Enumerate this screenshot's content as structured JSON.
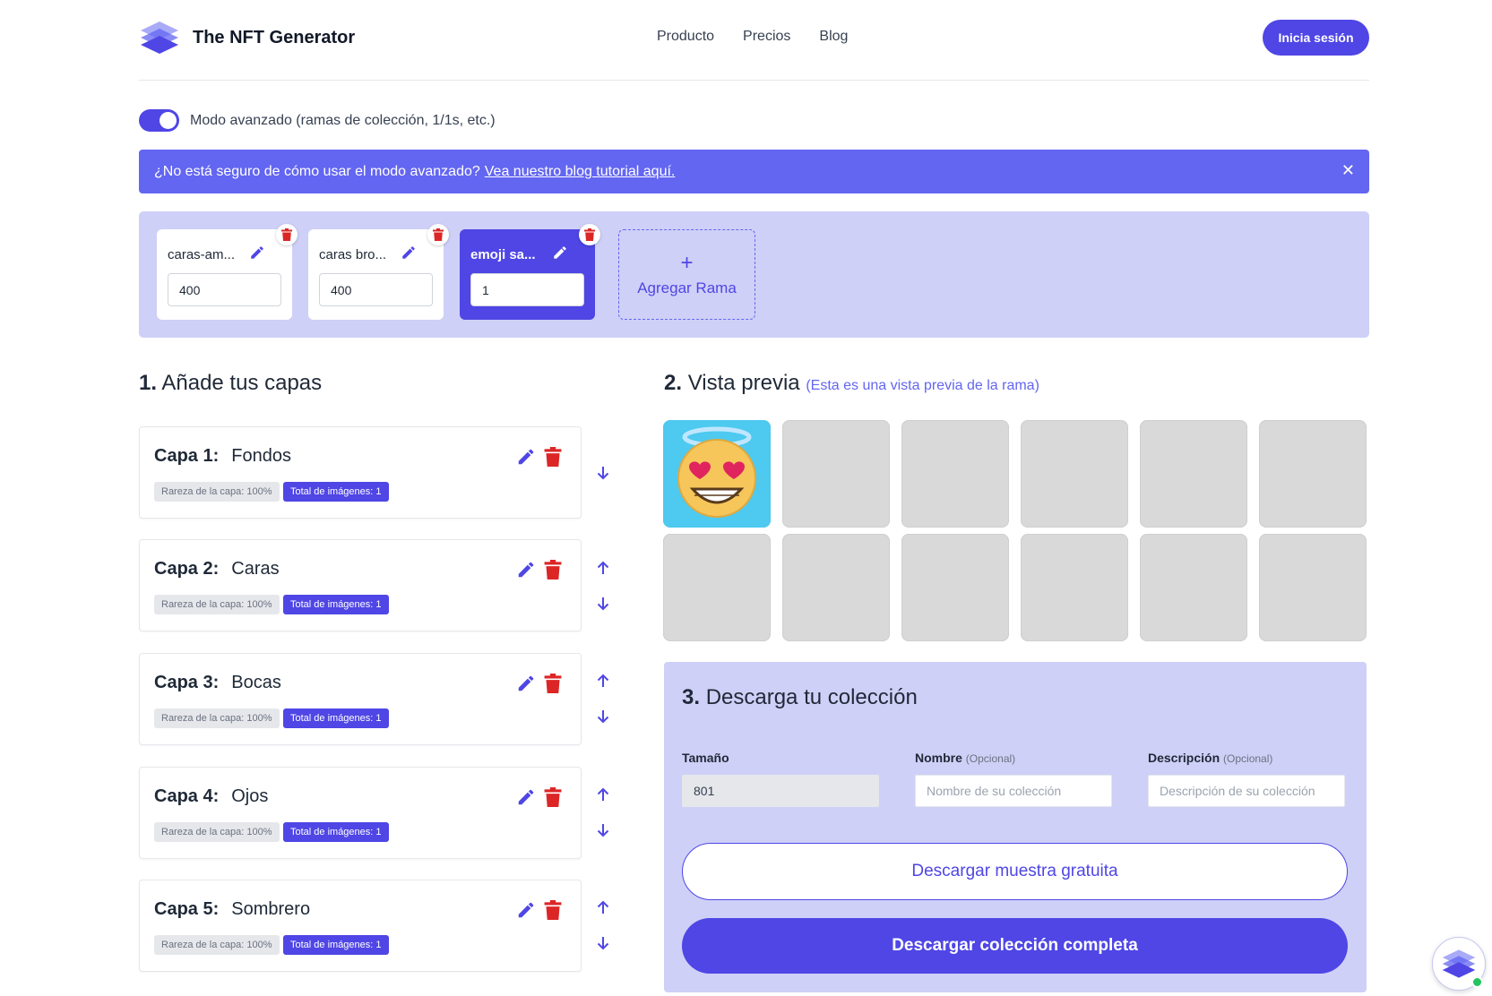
{
  "header": {
    "brand": "The NFT Generator",
    "nav": [
      "Producto",
      "Precios",
      "Blog"
    ],
    "login_label": "Inicia sesión"
  },
  "advanced": {
    "enabled": true,
    "label": "Modo avanzado (ramas de colección, 1/1s, etc.)"
  },
  "banner": {
    "text": "¿No está seguro de cómo usar el modo avanzado?",
    "link": "Vea nuestro blog tutorial aquí.",
    "close": "✕"
  },
  "branches": [
    {
      "name": "caras-am...",
      "value": "400",
      "active": false
    },
    {
      "name": "caras bro...",
      "value": "400",
      "active": false
    },
    {
      "name": "emoji sa...",
      "value": "1",
      "active": true
    }
  ],
  "add_branch": {
    "plus": "+",
    "label": "Agregar Rama"
  },
  "section1": {
    "num": "1.",
    "title": "Añade tus capas"
  },
  "layers": [
    {
      "label": "Capa 1:",
      "name": "Fondos",
      "rarity": "Rareza de la capa: 100%",
      "total": "Total de imágenes: 1"
    },
    {
      "label": "Capa 2:",
      "name": "Caras",
      "rarity": "Rareza de la capa: 100%",
      "total": "Total de imágenes: 1"
    },
    {
      "label": "Capa 3:",
      "name": "Bocas",
      "rarity": "Rareza de la capa: 100%",
      "total": "Total de imágenes: 1"
    },
    {
      "label": "Capa 4:",
      "name": "Ojos",
      "rarity": "Rareza de la capa: 100%",
      "total": "Total de imágenes: 1"
    },
    {
      "label": "Capa 5:",
      "name": "Sombrero",
      "rarity": "Rareza de la capa: 100%",
      "total": "Total de imágenes: 1"
    }
  ],
  "section2": {
    "num": "2.",
    "title": "Vista previa",
    "subtitle": "(Esta es una vista previa de la rama)"
  },
  "preview": {
    "filled_tiles": 1,
    "total_tiles": 12
  },
  "section3": {
    "num": "3.",
    "title": "Descarga tu colección",
    "size_label": "Tamaño",
    "size_value": "801",
    "name_label": "Nombre",
    "name_optional": "(Opcional)",
    "name_placeholder": "Nombre de su colección",
    "desc_label": "Descripción",
    "desc_optional": "(Opcional)",
    "desc_placeholder": "Descripción de su colección",
    "sample_button": "Descargar muestra gratuita",
    "full_button": "Descargar colección completa"
  },
  "colors": {
    "accent": "#4f46e5",
    "banner": "#6366f1",
    "panel": "#cfd0f7",
    "danger": "#dc2626",
    "online": "#22c55e"
  }
}
